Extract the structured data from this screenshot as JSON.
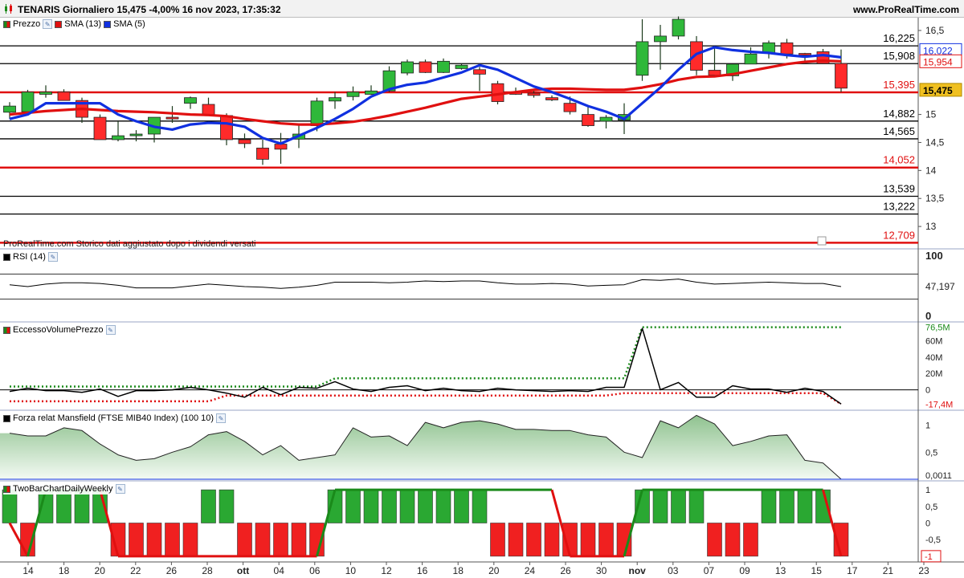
{
  "header": {
    "title": "TENARIS Giornaliero 15,475 -4,00% 16 nov 2023, 17:35:32",
    "brand": "www.ProRealTime.com"
  },
  "price_panel": {
    "legend": [
      {
        "label": "Prezzo",
        "color": "#1a8a1a"
      },
      {
        "label": "SMA (13)",
        "color": "#e01010"
      },
      {
        "label": "SMA (5)",
        "color": "#1030e0"
      }
    ],
    "note": "ProRealTime.com Storico dati aggiustato dopo i dividendi versati",
    "axis_ticks": [
      "16,5",
      "15",
      "14,5",
      "14",
      "13,5",
      "13"
    ],
    "levels": [
      {
        "value": 16.225,
        "label": "16,225",
        "color": "#000000"
      },
      {
        "value": 15.908,
        "label": "15,908",
        "color": "#000000"
      },
      {
        "value": 15.395,
        "label": "15,395",
        "color": "#e01010"
      },
      {
        "value": 14.882,
        "label": "14,882",
        "color": "#000000"
      },
      {
        "value": 14.565,
        "label": "14,565",
        "color": "#000000"
      },
      {
        "value": 14.052,
        "label": "14,052",
        "color": "#e01010"
      },
      {
        "value": 13.539,
        "label": "13,539",
        "color": "#000000"
      },
      {
        "value": 13.222,
        "label": "13,222",
        "color": "#000000"
      },
      {
        "value": 12.709,
        "label": "12,709",
        "color": "#e01010"
      }
    ],
    "badges": {
      "sma5": {
        "label": "16,022",
        "color": "#1030e0"
      },
      "sma13": {
        "label": "15,954",
        "color": "#e01010"
      },
      "price": {
        "label": "15,475",
        "color": "#f0c020"
      }
    }
  },
  "rsi_panel": {
    "legend": "RSI (14)",
    "axis_ticks": [
      "100",
      "0"
    ],
    "value_label": "47,197"
  },
  "evp_panel": {
    "legend": "EccessoVolumePrezzo",
    "axis_ticks": [
      "60M",
      "40M",
      "20M",
      "0"
    ],
    "upper_label": "76,5M",
    "lower_label": "-17,4M"
  },
  "mansfield_panel": {
    "legend": "Forza relat Mansfield (FTSE MIB40 Index) (100 10)",
    "axis_ticks": [
      "1",
      "0,5"
    ],
    "value_label": "0,0011"
  },
  "twobar_panel": {
    "legend": "TwoBarChartDailyWeekly",
    "axis_ticks": [
      "1",
      "0,5",
      "0",
      "-0,5"
    ],
    "value_label": "-1"
  },
  "x_axis": [
    "14",
    "18",
    "20",
    "22",
    "26",
    "28",
    "ott",
    "04",
    "06",
    "10",
    "12",
    "16",
    "18",
    "20",
    "24",
    "26",
    "30",
    "nov",
    "03",
    "07",
    "09",
    "13",
    "15",
    "17",
    "21",
    "23"
  ],
  "chart_data": {
    "type": "candlestick",
    "x": [
      "13 set",
      "14 set",
      "15 set",
      "18 set",
      "19 set",
      "20 set",
      "21 set",
      "22 set",
      "25 set",
      "26 set",
      "27 set",
      "28 set",
      "29 set",
      "2 ott",
      "3 ott",
      "4 ott",
      "5 ott",
      "6 ott",
      "9 ott",
      "10 ott",
      "11 ott",
      "12 ott",
      "13 ott",
      "16 ott",
      "17 ott",
      "18 ott",
      "19 ott",
      "20 ott",
      "23 ott",
      "24 ott",
      "25 ott",
      "26 ott",
      "27 ott",
      "30 ott",
      "31 ott",
      "1 nov",
      "2 nov",
      "3 nov",
      "6 nov",
      "7 nov",
      "8 nov",
      "9 nov",
      "10 nov",
      "13 nov",
      "14 nov",
      "15 nov",
      "16 nov"
    ],
    "open": [
      15.04,
      15.05,
      15.36,
      15.4,
      15.25,
      14.95,
      14.55,
      14.62,
      14.65,
      14.95,
      15.2,
      15.18,
      14.98,
      14.55,
      14.4,
      14.47,
      14.56,
      14.8,
      15.24,
      15.32,
      15.36,
      15.42,
      15.74,
      15.94,
      15.75,
      15.82,
      15.8,
      15.55,
      15.4,
      15.38,
      15.3,
      15.2,
      15.0,
      14.88,
      14.9,
      15.7,
      16.3,
      16.4,
      16.3,
      15.79,
      15.69,
      15.9,
      16.1,
      16.28,
      16.09,
      16.12,
      15.91
    ],
    "high": [
      15.22,
      15.44,
      15.52,
      15.45,
      15.3,
      15.0,
      14.88,
      14.72,
      14.78,
      15.15,
      15.32,
      15.3,
      15.02,
      14.66,
      14.55,
      14.67,
      14.82,
      15.3,
      15.4,
      15.5,
      15.52,
      15.86,
      15.98,
      15.98,
      16.0,
      15.9,
      15.85,
      15.6,
      15.48,
      15.44,
      15.34,
      15.32,
      15.15,
      14.99,
      15.2,
      16.7,
      16.6,
      16.75,
      16.4,
      16.2,
      15.9,
      16.2,
      16.32,
      16.35,
      16.1,
      16.17,
      16.16
    ],
    "low": [
      14.92,
      15.0,
      15.3,
      15.28,
      14.85,
      14.55,
      14.52,
      14.52,
      14.5,
      14.85,
      15.1,
      15.0,
      14.45,
      14.4,
      14.1,
      14.12,
      14.4,
      14.7,
      15.1,
      15.25,
      15.35,
      15.4,
      15.7,
      15.74,
      15.74,
      15.8,
      15.42,
      15.18,
      15.35,
      15.3,
      15.24,
      15.0,
      14.78,
      14.75,
      14.65,
      15.6,
      15.8,
      16.34,
      15.7,
      15.7,
      15.6,
      15.9,
      16.0,
      16.0,
      15.96,
      15.96,
      15.4
    ],
    "close": [
      15.15,
      15.4,
      15.4,
      15.25,
      14.95,
      14.55,
      14.62,
      14.65,
      14.95,
      14.92,
      15.3,
      15.0,
      14.55,
      14.48,
      14.2,
      14.38,
      14.65,
      15.24,
      15.3,
      15.4,
      15.42,
      15.78,
      15.94,
      15.75,
      15.95,
      15.88,
      15.72,
      15.23,
      15.36,
      15.34,
      15.26,
      15.05,
      14.8,
      14.95,
      15.0,
      16.3,
      16.4,
      16.7,
      15.79,
      15.7,
      15.9,
      16.08,
      16.28,
      16.08,
      16.06,
      15.91,
      15.47
    ],
    "sma5": [
      14.92,
      15.0,
      15.2,
      15.2,
      15.2,
      15.2,
      15.0,
      14.88,
      14.78,
      14.73,
      14.82,
      14.85,
      14.84,
      14.78,
      14.58,
      14.48,
      14.62,
      14.76,
      14.92,
      15.1,
      15.32,
      15.45,
      15.53,
      15.57,
      15.66,
      15.75,
      15.88,
      15.8,
      15.65,
      15.5,
      15.4,
      15.28,
      15.15,
      15.05,
      14.92,
      15.2,
      15.48,
      15.8,
      16.08,
      16.2,
      16.15,
      16.12,
      16.1,
      16.06,
      16.03,
      16.06,
      16.02
    ],
    "sma13": [
      15.0,
      15.03,
      15.06,
      15.08,
      15.1,
      15.08,
      15.06,
      15.05,
      15.04,
      15.02,
      15.0,
      14.99,
      14.97,
      14.92,
      14.88,
      14.84,
      14.82,
      14.82,
      14.84,
      14.87,
      14.92,
      14.98,
      15.05,
      15.12,
      15.2,
      15.28,
      15.32,
      15.36,
      15.4,
      15.44,
      15.46,
      15.46,
      15.45,
      15.44,
      15.44,
      15.48,
      15.54,
      15.62,
      15.67,
      15.68,
      15.72,
      15.78,
      15.84,
      15.9,
      15.94,
      15.96,
      15.95
    ],
    "rsi": [
      53,
      50,
      54,
      56,
      56,
      55,
      52,
      48,
      48,
      48,
      51,
      54,
      52,
      50,
      49,
      47,
      49,
      52,
      57,
      57,
      57,
      56,
      57,
      59,
      58,
      59,
      59,
      56,
      54,
      54,
      55,
      54,
      51,
      52,
      53,
      61,
      60,
      62,
      57,
      54,
      55,
      56,
      57,
      56,
      55,
      55,
      50
    ],
    "evp": [
      -2,
      2,
      -1,
      -1,
      -3,
      1,
      -8,
      -1,
      -1,
      0,
      3,
      0,
      -4,
      -9,
      3,
      -6,
      3,
      2,
      10,
      1,
      -2,
      3,
      5,
      -1,
      2,
      -1,
      -2,
      2,
      0,
      -1,
      -2,
      -1,
      -2,
      3,
      3,
      75,
      0,
      9,
      -9,
      -9,
      5,
      1,
      1,
      -3,
      2,
      -2,
      -17.4
    ],
    "evp_upper": [
      4,
      4,
      4,
      4,
      4,
      4,
      4,
      4,
      4,
      4,
      4,
      4,
      4,
      4,
      4,
      4,
      4,
      4,
      14,
      14,
      14,
      14,
      14,
      14,
      14,
      14,
      14,
      14,
      14,
      14,
      14,
      14,
      14,
      14,
      14,
      76.5,
      76.5,
      76.5,
      76.5,
      76.5,
      76.5,
      76.5,
      76.5,
      76.5,
      76.5,
      76.5,
      76.5
    ],
    "evp_lower": [
      -14,
      -14,
      -14,
      -14,
      -14,
      -14,
      -14,
      -14,
      -14,
      -14,
      -14,
      -14,
      -7,
      -7,
      -7,
      -7,
      -7,
      -7,
      -7,
      -7,
      -7,
      -7,
      -7,
      -7,
      -7,
      -7,
      -7,
      -7,
      -7,
      -7,
      -7,
      -7,
      -7,
      -7,
      -4,
      -4,
      -4,
      -4,
      -4,
      -4,
      -4,
      -4,
      -4,
      -4,
      -4,
      -4,
      -17.4
    ],
    "mansfield": [
      0.85,
      0.8,
      0.8,
      0.95,
      0.9,
      0.65,
      0.45,
      0.35,
      0.38,
      0.5,
      0.6,
      0.82,
      0.88,
      0.7,
      0.45,
      0.62,
      0.35,
      0.4,
      0.45,
      0.95,
      0.78,
      0.8,
      0.62,
      1.05,
      0.95,
      1.05,
      1.08,
      1.02,
      0.92,
      0.92,
      0.9,
      0.9,
      0.82,
      0.78,
      0.5,
      0.4,
      1.08,
      0.95,
      1.18,
      1.02,
      0.62,
      0.7,
      0.8,
      0.82,
      0.35,
      0.3,
      0.0011
    ],
    "twobar": [
      1,
      -1,
      1,
      1,
      1,
      1,
      -1,
      -1,
      -1,
      -1,
      -1,
      1,
      1,
      -1,
      -1,
      -1,
      -1,
      -1,
      1,
      1,
      1,
      1,
      1,
      1,
      1,
      1,
      1,
      -1,
      -1,
      -1,
      -1,
      -1,
      -1,
      -1,
      -1,
      1,
      1,
      1,
      1,
      -1,
      -1,
      -1,
      1,
      1,
      1,
      1,
      -1
    ],
    "twobar_line": [
      0,
      -1,
      1,
      1,
      1,
      1,
      -1,
      -1,
      -1,
      -1,
      -1,
      -1,
      -1,
      -1,
      -1,
      -1,
      -1,
      -1,
      1,
      1,
      1,
      1,
      1,
      1,
      1,
      1,
      1,
      1,
      1,
      1,
      1,
      -1,
      -1,
      -1,
      -1,
      1,
      1,
      1,
      1,
      1,
      1,
      1,
      1,
      1,
      1,
      1,
      -1
    ],
    "ylim_price": [
      12.6,
      16.7
    ],
    "ylim_rsi": [
      0,
      100
    ],
    "ylim_evp": [
      -20,
      80
    ],
    "ylim_mansfield": [
      0,
      1.2
    ],
    "ylim_twobar": [
      -1.1,
      1.1
    ]
  }
}
